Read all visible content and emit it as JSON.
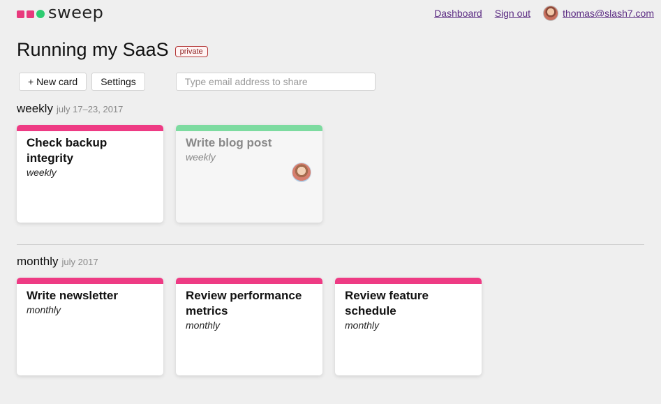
{
  "app": {
    "name": "sweep",
    "logo_colors": [
      "#e8397d",
      "#e8397d",
      "#2ecc71"
    ]
  },
  "nav": {
    "dashboard": "Dashboard",
    "signout": "Sign out",
    "user_email": "thomas@slash7.com"
  },
  "page": {
    "title": "Running my SaaS",
    "badge": "private"
  },
  "toolbar": {
    "new_card": "+ New card",
    "settings": "Settings",
    "share_placeholder": "Type email address to share"
  },
  "sections": [
    {
      "name": "weekly",
      "range": "july 17–23, 2017",
      "cards": [
        {
          "title": "Check backup integrity",
          "subtitle": "weekly",
          "status": "todo",
          "color": "#ee3b84"
        },
        {
          "title": "Write blog post",
          "subtitle": "weekly",
          "status": "done",
          "color": "#7ddba0"
        }
      ]
    },
    {
      "name": "monthly",
      "range": "july 2017",
      "cards": [
        {
          "title": "Write newsletter",
          "subtitle": "monthly",
          "status": "todo",
          "color": "#ee3b84"
        },
        {
          "title": "Review performance metrics",
          "subtitle": "monthly",
          "status": "todo",
          "color": "#ee3b84"
        },
        {
          "title": "Review feature schedule",
          "subtitle": "monthly",
          "status": "todo",
          "color": "#ee3b84"
        }
      ]
    }
  ]
}
